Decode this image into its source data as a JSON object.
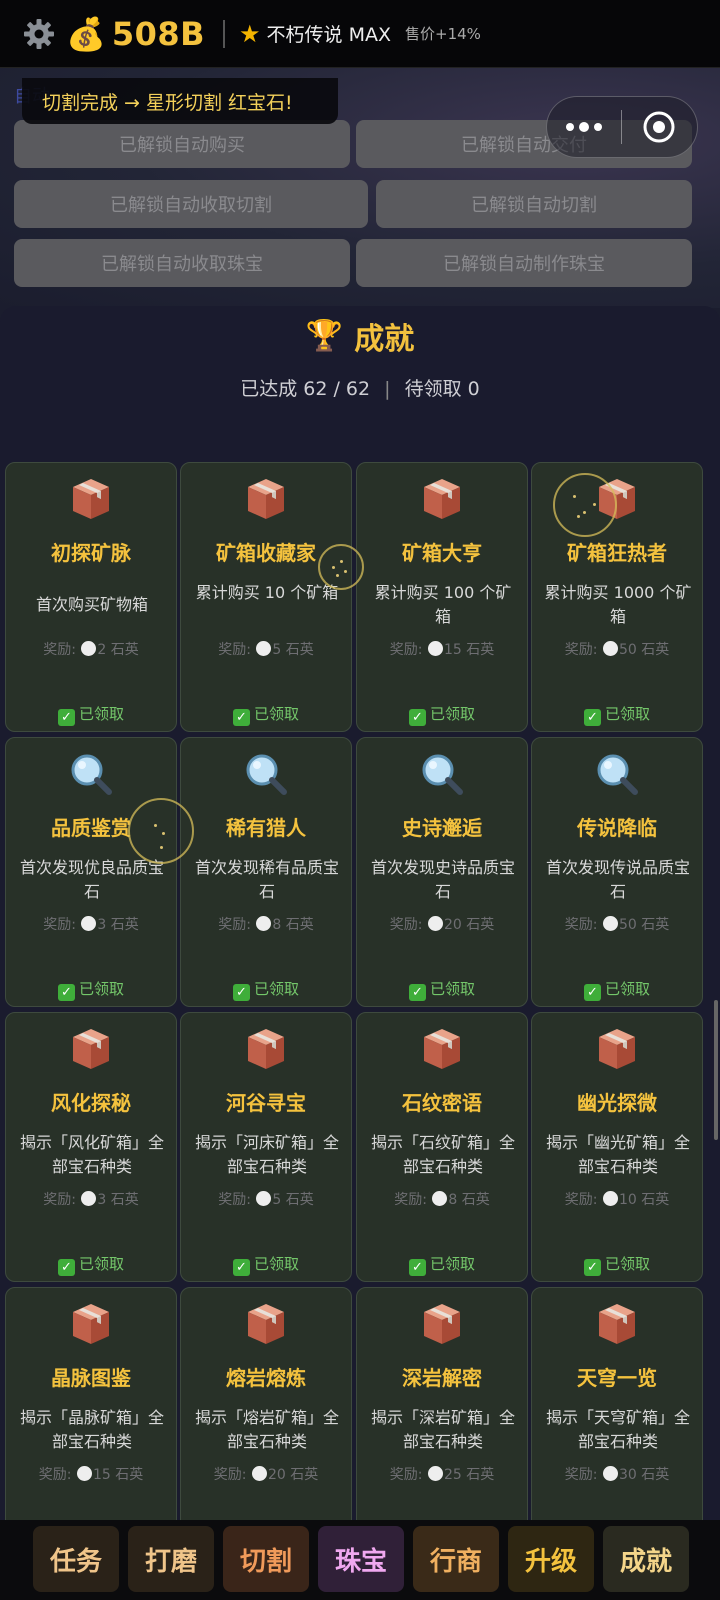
{
  "topbar": {
    "coins": "508B",
    "tier": "不朽传说 MAX",
    "price_bonus": "售价+14%"
  },
  "toast": "切割完成 → 星形切割 红宝石!",
  "hidden_label": "自动",
  "unlock_buttons": [
    "已解锁自动购买",
    "已解锁自动交付",
    "已解锁自动收取切割",
    "已解锁自动切割",
    "已解锁自动收取珠宝",
    "已解锁自动制作珠宝"
  ],
  "achievements": {
    "title": "成就",
    "summary": "已达成 62 / 62",
    "pending": "待领取 0",
    "reward_label": "奖励:",
    "reward_unit": "石英",
    "status_label": "已领取",
    "items": [
      {
        "name": "初探矿脉",
        "desc": "首次购买矿物箱",
        "reward": "2",
        "icon": "box-icon"
      },
      {
        "name": "矿箱收藏家",
        "desc": "累计购买 10 个矿箱",
        "reward": "5",
        "icon": "box-icon"
      },
      {
        "name": "矿箱大亨",
        "desc": "累计购买 100 个矿箱",
        "reward": "15",
        "icon": "box-icon"
      },
      {
        "name": "矿箱狂热者",
        "desc": "累计购买 1000 个矿箱",
        "reward": "50",
        "icon": "box-icon"
      },
      {
        "name": "品质鉴赏",
        "desc": "首次发现优良品质宝石",
        "reward": "3",
        "icon": "magnifier-icon"
      },
      {
        "name": "稀有猎人",
        "desc": "首次发现稀有品质宝石",
        "reward": "8",
        "icon": "magnifier-icon"
      },
      {
        "name": "史诗邂逅",
        "desc": "首次发现史诗品质宝石",
        "reward": "20",
        "icon": "magnifier-icon"
      },
      {
        "name": "传说降临",
        "desc": "首次发现传说品质宝石",
        "reward": "50",
        "icon": "magnifier-icon"
      },
      {
        "name": "风化探秘",
        "desc": "揭示「风化矿箱」全部宝石种类",
        "reward": "3",
        "icon": "box-icon"
      },
      {
        "name": "河谷寻宝",
        "desc": "揭示「河床矿箱」全部宝石种类",
        "reward": "5",
        "icon": "box-icon"
      },
      {
        "name": "石纹密语",
        "desc": "揭示「石纹矿箱」全部宝石种类",
        "reward": "8",
        "icon": "box-icon"
      },
      {
        "name": "幽光探微",
        "desc": "揭示「幽光矿箱」全部宝石种类",
        "reward": "10",
        "icon": "box-icon"
      },
      {
        "name": "晶脉图鉴",
        "desc": "揭示「晶脉矿箱」全部宝石种类",
        "reward": "15",
        "icon": "box-icon"
      },
      {
        "name": "熔岩熔炼",
        "desc": "揭示「熔岩矿箱」全部宝石种类",
        "reward": "20",
        "icon": "box-icon"
      },
      {
        "name": "深岩解密",
        "desc": "揭示「深岩矿箱」全部宝石种类",
        "reward": "25",
        "icon": "box-icon"
      },
      {
        "name": "天穹一览",
        "desc": "揭示「天穹矿箱」全部宝石种类",
        "reward": "30",
        "icon": "box-icon"
      }
    ]
  },
  "nav": [
    "任务",
    "打磨",
    "切割",
    "珠宝",
    "行商",
    "升级",
    "成就"
  ],
  "colors": {
    "accent": "#f4c23e",
    "card_bg": "#283128",
    "claimed": "#74c76a"
  }
}
